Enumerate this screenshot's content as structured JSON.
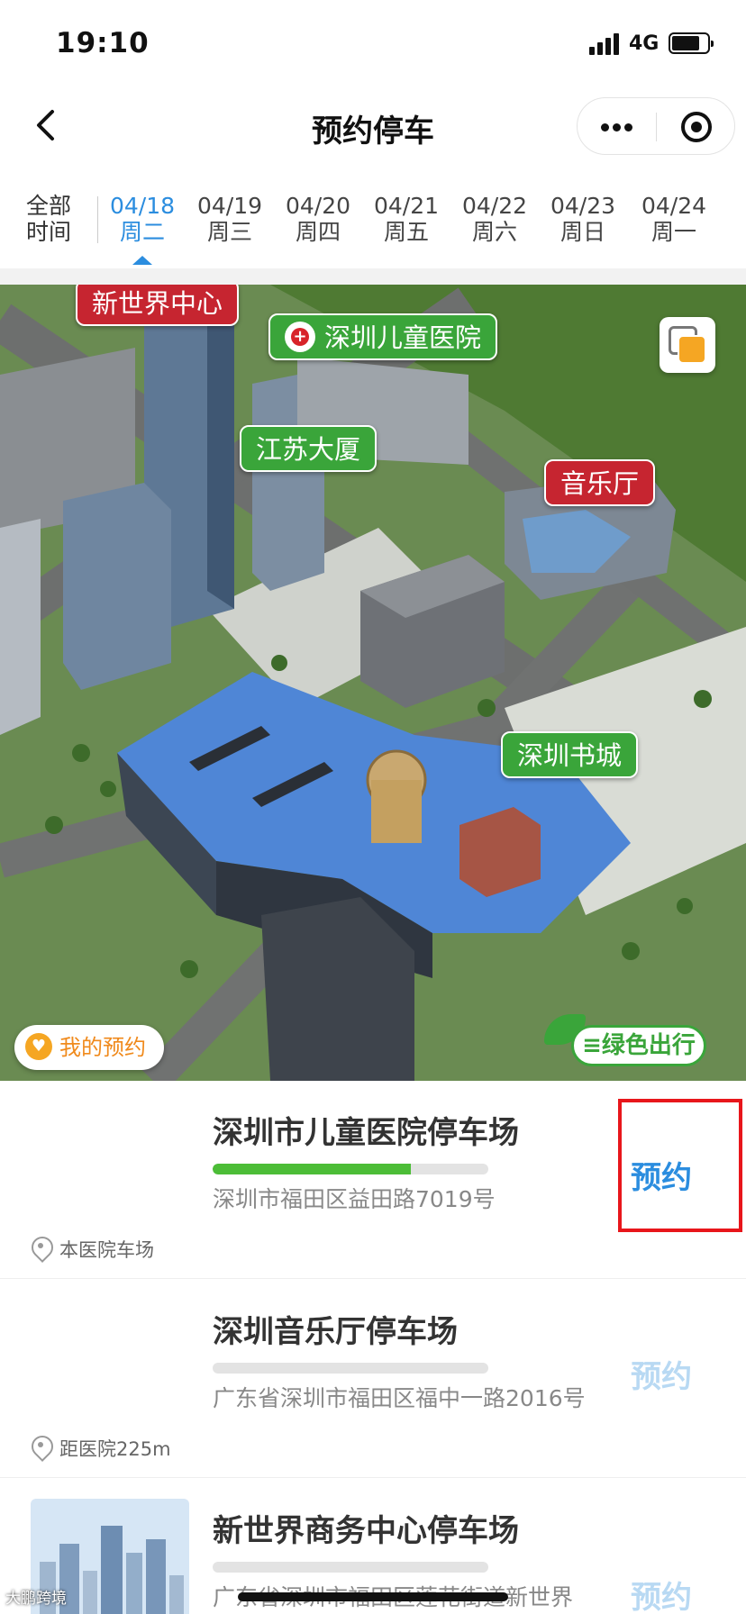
{
  "status_bar": {
    "time": "19:10",
    "network": "4G"
  },
  "nav": {
    "title": "预约停车"
  },
  "tabs": {
    "all_line1": "全部",
    "all_line2": "时间",
    "dates": [
      {
        "date": "04/18",
        "weekday": "周二",
        "active": true
      },
      {
        "date": "04/19",
        "weekday": "周三",
        "active": false
      },
      {
        "date": "04/20",
        "weekday": "周四",
        "active": false
      },
      {
        "date": "04/21",
        "weekday": "周五",
        "active": false
      },
      {
        "date": "04/22",
        "weekday": "周六",
        "active": false
      },
      {
        "date": "04/23",
        "weekday": "周日",
        "active": false
      },
      {
        "date": "04/24",
        "weekday": "周一",
        "active": false
      }
    ]
  },
  "map": {
    "labels": {
      "new_world": "新世界中心",
      "children_hospital": "深圳儿童医院",
      "jiangsu_building": "江苏大厦",
      "concert_hall": "音乐厅",
      "book_city": "深圳书城"
    },
    "my_booking": "我的预约",
    "green_trip": "≡绿色出行"
  },
  "lots": [
    {
      "name": "深圳市儿童医院停车场",
      "address": "深圳市福田区益田路7019号",
      "location": "本医院车场",
      "availability": 0.72,
      "button": "预约",
      "enabled": true
    },
    {
      "name": "深圳音乐厅停车场",
      "address": "广东省深圳市福田区福中一路2016号",
      "location": "距医院225m",
      "availability": 0,
      "button": "预约",
      "enabled": false
    },
    {
      "name": "新世界商务中心停车场",
      "address": "广东省深圳市福田区莲花街道新世界",
      "button": "预约",
      "enabled": false
    }
  ],
  "watermark": "大鹏跨境",
  "colors": {
    "accent": "#2b8ddf",
    "bar_green": "#4cbd37",
    "highlight_red": "#e8161b",
    "label_red": "#c62530",
    "label_green": "#3aa53a"
  }
}
